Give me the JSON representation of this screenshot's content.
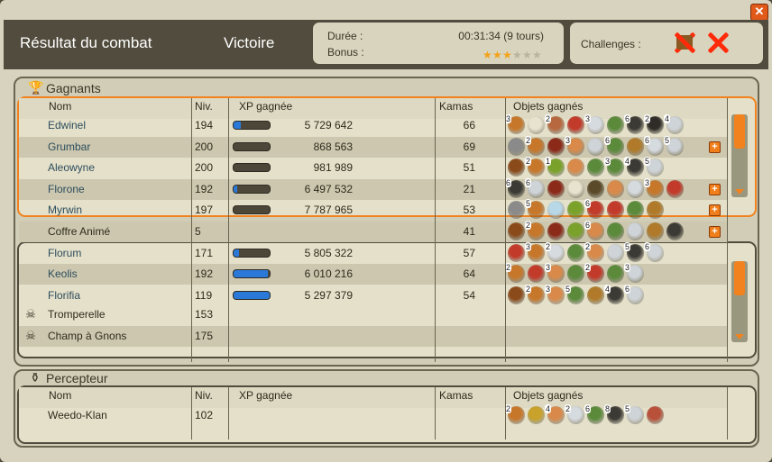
{
  "window": {
    "close_label": "✕"
  },
  "header": {
    "title": "Résultat du combat",
    "result": "Victoire",
    "duration_label": "Durée :",
    "duration_value": "00:31:34 (9 tours)",
    "bonus_label": "Bonus :",
    "bonus_stars_filled": 3,
    "bonus_stars_total": 6,
    "challenges_label": "Challenges :"
  },
  "colors": {
    "accent": "#f2821e",
    "xp_bar": "#2a79d8",
    "header_bg": "#514c3d",
    "name_link": "#2e4d5e"
  },
  "winners": {
    "section_label": "Gagnants",
    "columns": [
      "Nom",
      "Niv.",
      "XP gagnée",
      "Kamas",
      "Objets gagnés"
    ],
    "rows": [
      {
        "name": "Edwinel",
        "level": "194",
        "xp": "5 729 642",
        "xp_fill": 0.2,
        "kamas": "66",
        "plus": false,
        "items": [
          {
            "n": "3",
            "c": "#c7772a"
          },
          {
            "n": "",
            "c": "#e8e3cf"
          },
          {
            "n": "2",
            "c": "#b7683e"
          },
          {
            "n": "",
            "c": "#c23a2a"
          },
          {
            "n": "3",
            "c": "#d6dbe0"
          },
          {
            "n": "",
            "c": "#5b8a3b"
          },
          {
            "n": "6",
            "c": "#3c3a34"
          },
          {
            "n": "2",
            "c": "#2f2c28"
          },
          {
            "n": "4",
            "c": "#cfd4d8"
          }
        ]
      },
      {
        "name": "Grumbar",
        "level": "200",
        "xp": "868 563",
        "xp_fill": 0.0,
        "kamas": "69",
        "plus": true,
        "items": [
          {
            "n": "",
            "c": "#8a8a8a"
          },
          {
            "n": "2",
            "c": "#c7772a"
          },
          {
            "n": "",
            "c": "#8c2a1a"
          },
          {
            "n": "3",
            "c": "#d98a4a"
          },
          {
            "n": "",
            "c": "#cfd4d8"
          },
          {
            "n": "6",
            "c": "#5b8a3b"
          },
          {
            "n": "",
            "c": "#b07a2a"
          },
          {
            "n": "6",
            "c": "#d6dbe0"
          },
          {
            "n": "5",
            "c": "#cfd4d8"
          }
        ]
      },
      {
        "name": "Aleowyne",
        "level": "200",
        "xp": "981 989",
        "xp_fill": 0.0,
        "kamas": "51",
        "plus": false,
        "items": [
          {
            "n": "",
            "c": "#8a4a1a"
          },
          {
            "n": "2",
            "c": "#c7772a"
          },
          {
            "n": "1",
            "c": "#7aa22a"
          },
          {
            "n": "",
            "c": "#d98a4a"
          },
          {
            "n": "",
            "c": "#5b8a3b"
          },
          {
            "n": "3",
            "c": "#5b8a3b"
          },
          {
            "n": "4",
            "c": "#3c3a34"
          },
          {
            "n": "5",
            "c": "#cfd4d8"
          }
        ]
      },
      {
        "name": "Florone",
        "level": "192",
        "xp": "6 497 532",
        "xp_fill": 0.1,
        "kamas": "21",
        "plus": true,
        "items": [
          {
            "n": "6",
            "c": "#3c3a34"
          },
          {
            "n": "6",
            "c": "#cfd4d8"
          },
          {
            "n": "",
            "c": "#8c2a1a"
          },
          {
            "n": "",
            "c": "#e8e3cf"
          },
          {
            "n": "",
            "c": "#5b4a2a"
          },
          {
            "n": "",
            "c": "#d98a4a"
          },
          {
            "n": "",
            "c": "#d6dbe0"
          },
          {
            "n": "3",
            "c": "#c7772a"
          },
          {
            "n": "",
            "c": "#c23a2a"
          }
        ]
      },
      {
        "name": "Myrwin",
        "level": "197",
        "xp": "7 787 965",
        "xp_fill": 0.0,
        "kamas": "53",
        "plus": true,
        "items": [
          {
            "n": "",
            "c": "#8a8a8a"
          },
          {
            "n": "5",
            "c": "#c7772a"
          },
          {
            "n": "",
            "c": "#b8d8e8"
          },
          {
            "n": "",
            "c": "#7aa22a"
          },
          {
            "n": "6",
            "c": "#c23a2a"
          },
          {
            "n": "",
            "c": "#c23a2a"
          },
          {
            "n": "",
            "c": "#5b8a3b"
          },
          {
            "n": "",
            "c": "#b07a2a"
          }
        ]
      },
      {
        "name": "Coffre Animé",
        "level": "5",
        "xp": "",
        "xp_fill": null,
        "kamas": "41",
        "plus": true,
        "plain": true,
        "items": [
          {
            "n": "",
            "c": "#8a4a1a"
          },
          {
            "n": "2",
            "c": "#c7772a"
          },
          {
            "n": "",
            "c": "#8c2a1a"
          },
          {
            "n": "",
            "c": "#7aa22a"
          },
          {
            "n": "6",
            "c": "#d98a4a"
          },
          {
            "n": "",
            "c": "#5b8a3b"
          },
          {
            "n": "",
            "c": "#cfd4d8"
          },
          {
            "n": "",
            "c": "#b07a2a"
          },
          {
            "n": "",
            "c": "#3c3a34"
          }
        ]
      },
      {
        "name": "Florum",
        "level": "171",
        "xp": "5 805 322",
        "xp_fill": 0.15,
        "kamas": "57",
        "plus": false,
        "items": [
          {
            "n": "",
            "c": "#c23a2a"
          },
          {
            "n": "3",
            "c": "#c7772a"
          },
          {
            "n": "2",
            "c": "#d6dbe0"
          },
          {
            "n": "",
            "c": "#5b8a3b"
          },
          {
            "n": "2",
            "c": "#d98a4a"
          },
          {
            "n": "",
            "c": "#cfd4d8"
          },
          {
            "n": "5",
            "c": "#3c3a34"
          },
          {
            "n": "6",
            "c": "#cfd4d8"
          }
        ]
      },
      {
        "name": "Keolis",
        "level": "192",
        "xp": "6 010 216",
        "xp_fill": 0.95,
        "kamas": "64",
        "plus": false,
        "items": [
          {
            "n": "2",
            "c": "#c7772a"
          },
          {
            "n": "",
            "c": "#c23a2a"
          },
          {
            "n": "3",
            "c": "#d98a4a"
          },
          {
            "n": "",
            "c": "#5b8a3b"
          },
          {
            "n": "2",
            "c": "#c23a2a"
          },
          {
            "n": "",
            "c": "#5b8a3b"
          },
          {
            "n": "3",
            "c": "#cfd4d8"
          }
        ]
      },
      {
        "name": "Florifia",
        "level": "119",
        "xp": "5 297 379",
        "xp_fill": 1.0,
        "kamas": "54",
        "plus": false,
        "items": [
          {
            "n": "",
            "c": "#8a4a1a"
          },
          {
            "n": "2",
            "c": "#c7772a"
          },
          {
            "n": "3",
            "c": "#d98a4a"
          },
          {
            "n": "5",
            "c": "#5b8a3b"
          },
          {
            "n": "",
            "c": "#b07a2a"
          },
          {
            "n": "4",
            "c": "#3c3a34"
          },
          {
            "n": "6",
            "c": "#cfd4d8"
          }
        ]
      }
    ]
  },
  "losers": {
    "rows": [
      {
        "name": "Tromperelle",
        "level": "153"
      },
      {
        "name": "Champ à Gnons",
        "level": "175"
      }
    ]
  },
  "tax_collector": {
    "section_label": "Percepteur",
    "columns": [
      "Nom",
      "Niv.",
      "XP gagnée",
      "Kamas",
      "Objets gagnés"
    ],
    "rows": [
      {
        "name": "Weedo-Klan",
        "level": "102",
        "items": [
          {
            "n": "2",
            "c": "#c7772a"
          },
          {
            "n": "",
            "c": "#c8a22a"
          },
          {
            "n": "4",
            "c": "#d98a4a"
          },
          {
            "n": "2",
            "c": "#d6dbe0"
          },
          {
            "n": "6",
            "c": "#5b8a3b"
          },
          {
            "n": "8",
            "c": "#3c3a34"
          },
          {
            "n": "5",
            "c": "#cfd4d8"
          },
          {
            "n": "",
            "c": "#b8503a"
          }
        ]
      }
    ]
  }
}
